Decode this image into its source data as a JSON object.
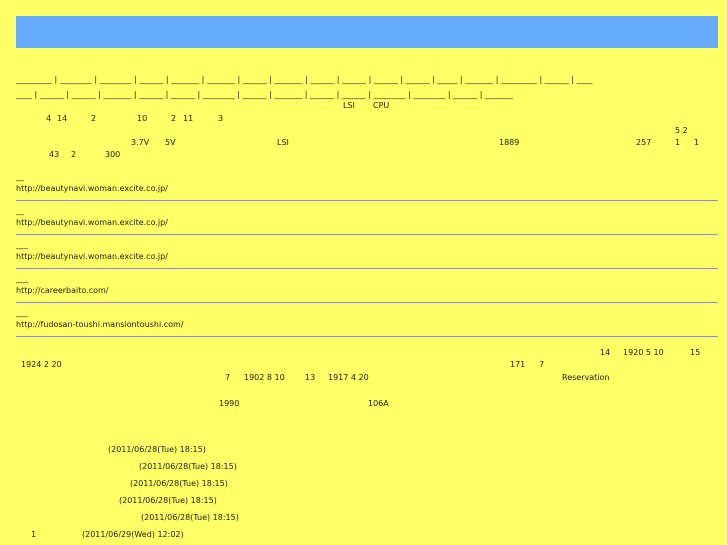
{
  "colors": {
    "background": "#ffff66",
    "banner": "#66aaff",
    "divider": "#8888ff"
  },
  "nav": {
    "row1": "_________ | ________ | ________ | ______ | _______ | _______ | ______ | _______ | ______ | ______ | ______ | ______ | _____ | _______ | _________ | ______ | ____",
    "row2": "____ | ______ | ______ | _______ | ______ | ______ | ________ | ______ | _______ | ______ | ______ | ________ | ________ | ______ | _______"
  },
  "intro": {
    "lsi": "LSI",
    "cpu": "CPU",
    "n4": "4",
    "n14": "14",
    "n2a": "2",
    "n10": "10",
    "n2b": "2",
    "n11": "11",
    "n3": "3",
    "n52": "5 2",
    "v37": "3.7V",
    "v5": "5V",
    "lsi2": "LSI",
    "y1889": "1889",
    "n257": "257",
    "n1a": "1",
    "n1b": "1",
    "n43": "43",
    "n2c": "2",
    "n300": "300"
  },
  "links": [
    {
      "dash": "__",
      "url": "http://beautynavi.woman.excite.co.jp/"
    },
    {
      "dash": "__",
      "url": "http://beautynavi.woman.excite.co.jp/"
    },
    {
      "dash": "___",
      "url": "http://beautynavi.woman.excite.co.jp/"
    },
    {
      "dash": "___",
      "url": "http://careerbaito.com/"
    },
    {
      "dash": "___",
      "url": "http://fudosan-toushi.mansiontoushi.com/"
    }
  ],
  "history": {
    "n14": "14",
    "d1920": "1920 5 10",
    "n15": "15",
    "d1924": "1924 2 20",
    "n171": "171",
    "n7a": "7",
    "n7b": "7",
    "d1902": "1902 8 10",
    "n13": "13",
    "d1917": "1917 4 20",
    "reservation": "Reservation",
    "y1990": "1990",
    "a106": "106A"
  },
  "comments": [
    {
      "prefix": "",
      "stamp": "(2011/06/28(Tue) 18:15)"
    },
    {
      "prefix": "",
      "stamp": "(2011/06/28(Tue) 18:15)"
    },
    {
      "prefix": "",
      "stamp": "(2011/06/28(Tue) 18:15)"
    },
    {
      "prefix": "",
      "stamp": "(2011/06/28(Tue) 18:15)"
    },
    {
      "prefix": "",
      "stamp": "(2011/06/28(Tue) 18:15)"
    },
    {
      "prefix": "1",
      "stamp": "(2011/06/29(Wed) 12:02)"
    }
  ]
}
